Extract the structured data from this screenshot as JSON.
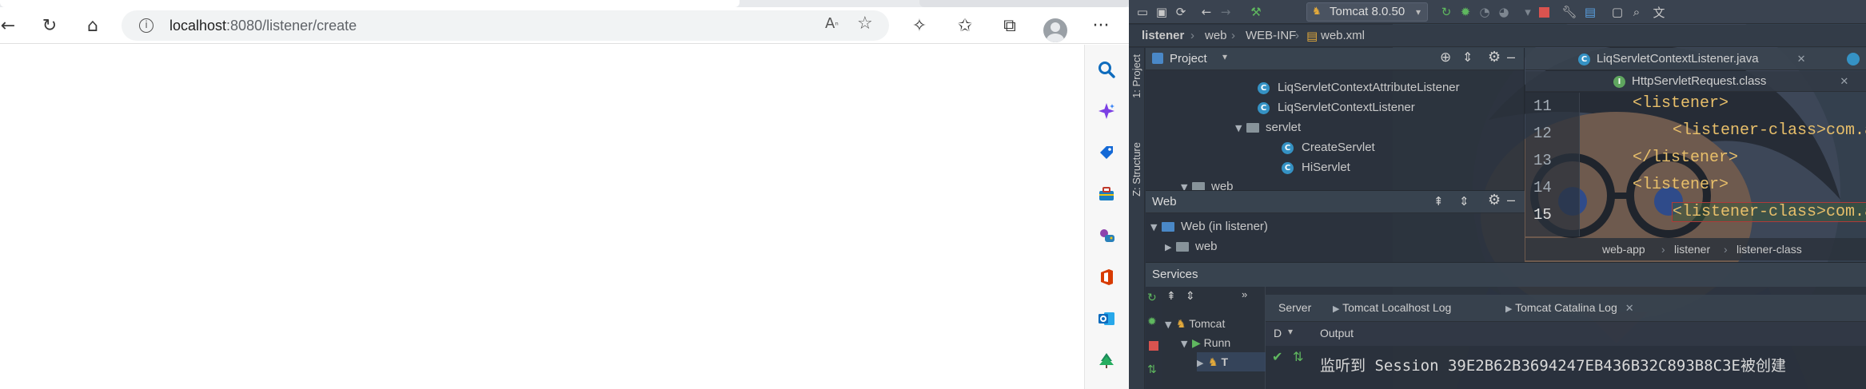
{
  "browser": {
    "address": {
      "host": "localhost",
      "rest": ":8080/listener/create"
    },
    "nav": {
      "back_icon": "arrow-left-icon",
      "reload_icon": "reload-icon",
      "home_icon": "home-icon"
    },
    "toolbar_icons": [
      "read-aloud-icon",
      "add-favorite-icon",
      "extensions-icon",
      "favorites-icon",
      "collections-icon",
      "profile-icon",
      "more-icon"
    ],
    "sidebar_icons": [
      "search-icon",
      "copilot-icon",
      "shopping-icon",
      "tools-icon",
      "games-icon",
      "office-icon",
      "outlook-icon",
      "tree-icon"
    ],
    "colors": {
      "accent": "#0078d4",
      "office": "#d83b01",
      "outlook": "#0f6cbd",
      "tree": "#1b8a5a"
    }
  },
  "ide": {
    "run_config": "Tomcat 8.0.50",
    "nav_path": [
      "listener",
      "web",
      "WEB-INF",
      "web.xml"
    ],
    "vertical_tabs": {
      "project": "1: Project",
      "structure": "Z: Structure"
    },
    "project_panel": {
      "title": "Project",
      "items": [
        {
          "type": "class",
          "label": "LiqServletContextAttributeListener"
        },
        {
          "type": "class",
          "label": "LiqServletContextListener"
        },
        {
          "type": "package",
          "label": "servlet"
        },
        {
          "type": "class",
          "label": "CreateServlet"
        },
        {
          "type": "class",
          "label": "HiServlet"
        },
        {
          "type": "dir",
          "label": "web"
        }
      ]
    },
    "web_panel": {
      "title": "Web",
      "items": [
        {
          "label": "Web (in listener)"
        },
        {
          "label": "web"
        }
      ]
    },
    "editor": {
      "tabs": [
        "LiqServletContextListener.java",
        "HttpServletRequest.class"
      ],
      "lines": [
        {
          "number": "11",
          "indent": 1,
          "text": "<listener>"
        },
        {
          "number": "12",
          "indent": 2,
          "text": "<listener-class>com.a"
        },
        {
          "number": "13",
          "indent": 1,
          "text": "</listener>"
        },
        {
          "number": "14",
          "indent": 1,
          "text": "<listener>"
        },
        {
          "number": "15",
          "indent": 2,
          "text": "<listener-class>com.a"
        }
      ],
      "breadcrumb": [
        "web-app",
        "listener",
        "listener-class"
      ]
    },
    "services": {
      "title": "Services",
      "tree": [
        "Tomcat",
        "Runn",
        "T"
      ],
      "tabs": [
        "Server",
        "Tomcat Localhost Log",
        "Tomcat Catalina Log"
      ],
      "output_label": "Output",
      "deploy_label": "D",
      "console_line": "监听到 Session 39E2B62B3694247EB436B32C893B8C3E被创建"
    }
  }
}
